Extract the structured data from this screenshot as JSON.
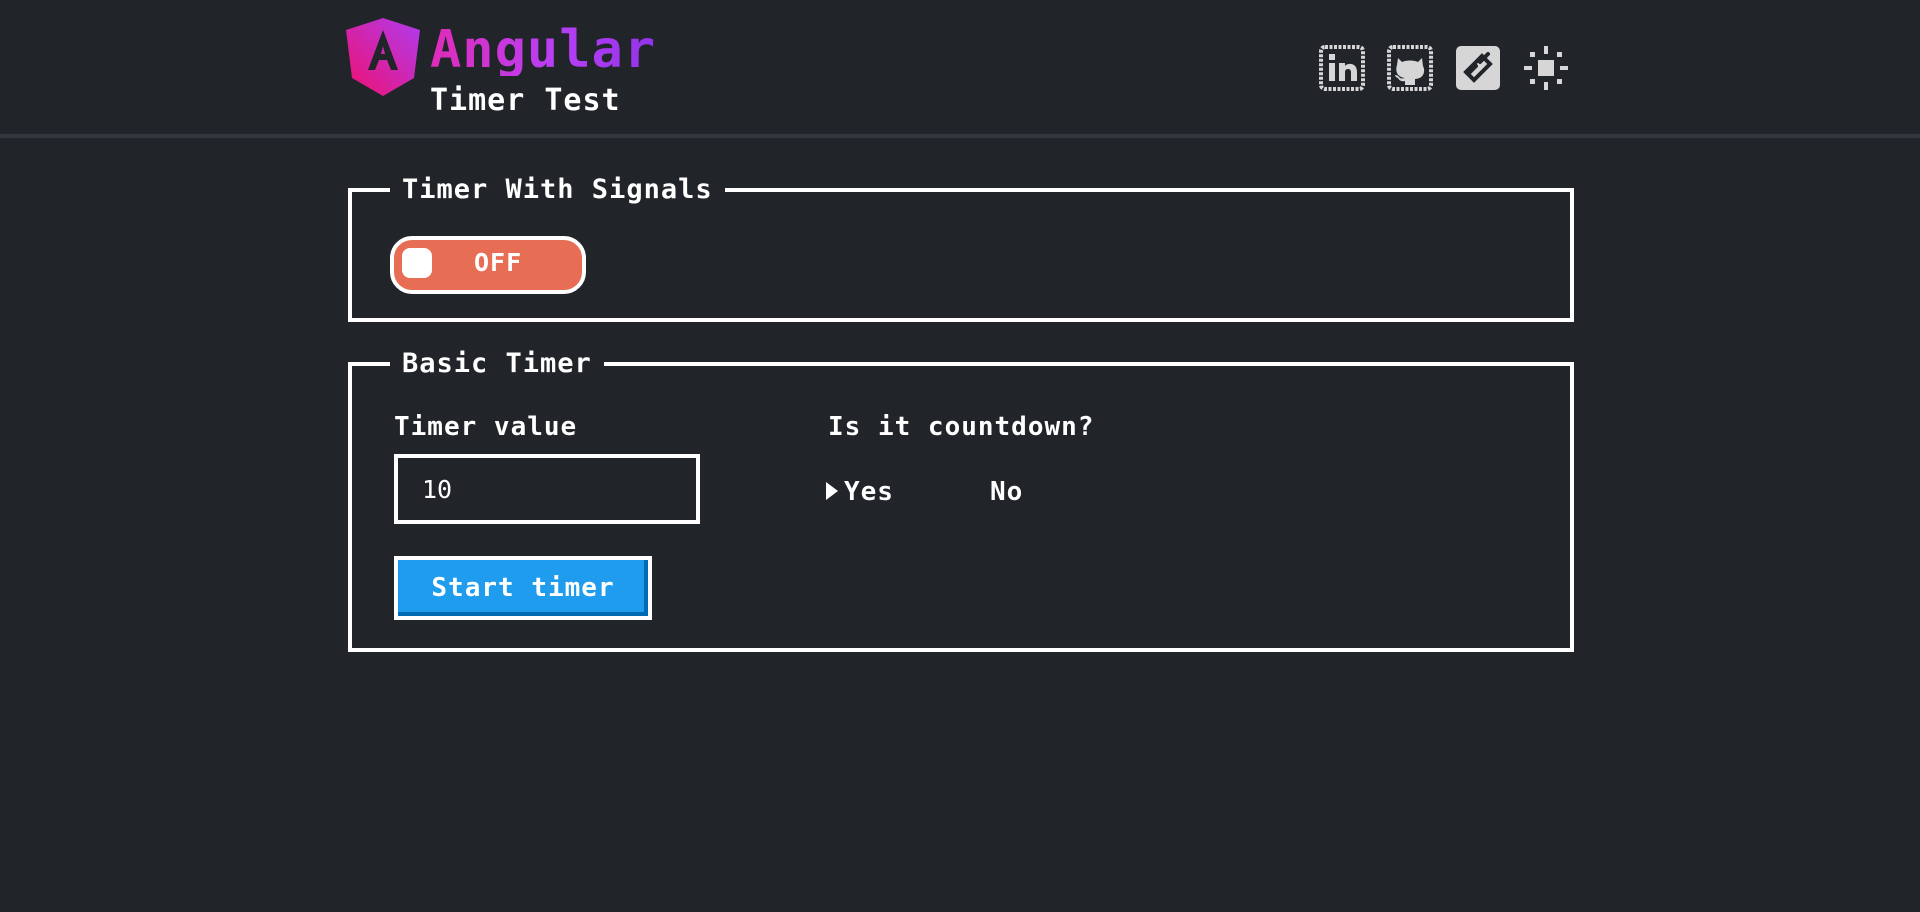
{
  "header": {
    "brand_name": "Angular",
    "subtitle": "Timer Test",
    "icons": [
      "linkedin-icon",
      "github-icon",
      "link-icon",
      "sun-icon"
    ]
  },
  "signals_panel": {
    "legend": "Timer With Signals",
    "toggle_label": "OFF",
    "toggle_on": false
  },
  "basic_panel": {
    "legend": "Basic Timer",
    "timer_label": "Timer value",
    "timer_value": "10",
    "countdown_label": "Is it countdown?",
    "options": [
      {
        "label": "Yes",
        "selected": true
      },
      {
        "label": "No",
        "selected": false
      }
    ],
    "start_label": "Start timer"
  },
  "colors": {
    "background": "#212429",
    "toggle_off": "#e76e55",
    "primary_button": "#209cee",
    "brand_gradient": [
      "#e02cb7",
      "#9333ea"
    ]
  }
}
